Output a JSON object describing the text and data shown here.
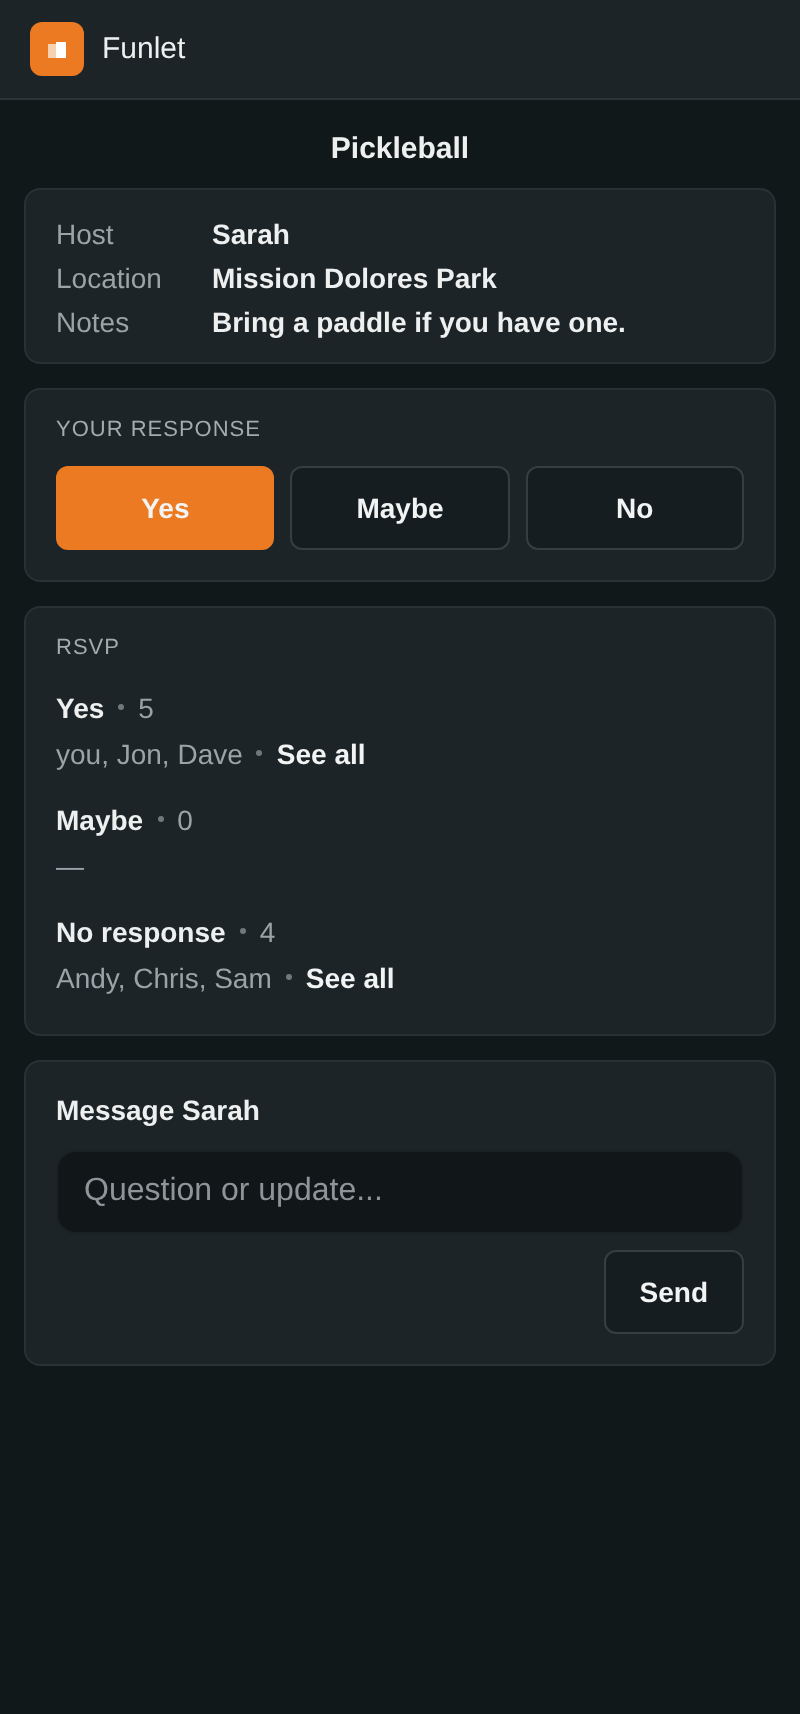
{
  "app": {
    "name": "Funlet"
  },
  "event": {
    "title": "Pickleball",
    "details": [
      {
        "label": "Host",
        "value": "Sarah"
      },
      {
        "label": "Location",
        "value": "Mission Dolores Park"
      },
      {
        "label": "Notes",
        "value": "Bring a paddle if you have one."
      }
    ]
  },
  "response": {
    "heading": "YOUR RESPONSE",
    "options": [
      {
        "label": "Yes",
        "selected": true
      },
      {
        "label": "Maybe",
        "selected": false
      },
      {
        "label": "No",
        "selected": false
      }
    ]
  },
  "rsvp": {
    "heading": "RSVP",
    "groups": [
      {
        "label": "Yes",
        "count": "5",
        "names": "you, Jon, Dave",
        "link": "See all"
      },
      {
        "label": "Maybe",
        "count": "0",
        "names": "—"
      },
      {
        "label": "No response",
        "count": "4",
        "names": "Andy, Chris, Sam",
        "link": "See all"
      }
    ]
  },
  "message": {
    "heading": "Message Sarah",
    "placeholder": "Question or update...",
    "button": "Send"
  }
}
